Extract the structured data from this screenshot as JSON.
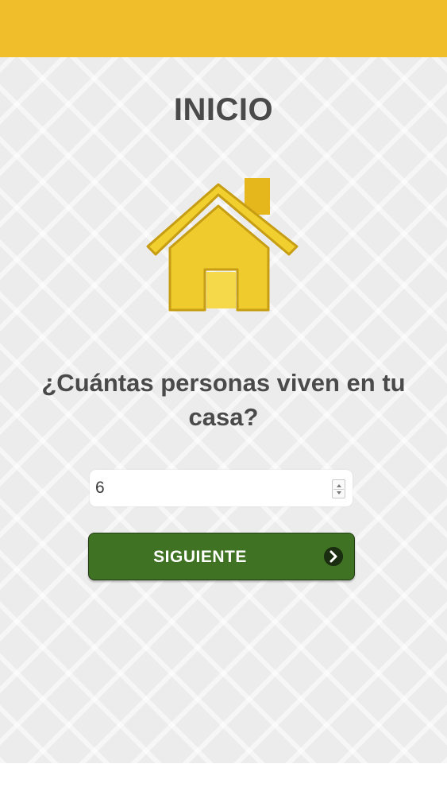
{
  "header": {
    "accent_color": "#f0be2b"
  },
  "page": {
    "title": "INICIO",
    "hero_icon": "house-icon",
    "icon_color": "#f0cf2e"
  },
  "question": {
    "text": "¿Cuántas personas viven en tu casa?"
  },
  "people_input": {
    "value": "6"
  },
  "next_button": {
    "label": "SIGUIENTE",
    "icon": "chevron-right-icon",
    "color": "#3f7323"
  }
}
